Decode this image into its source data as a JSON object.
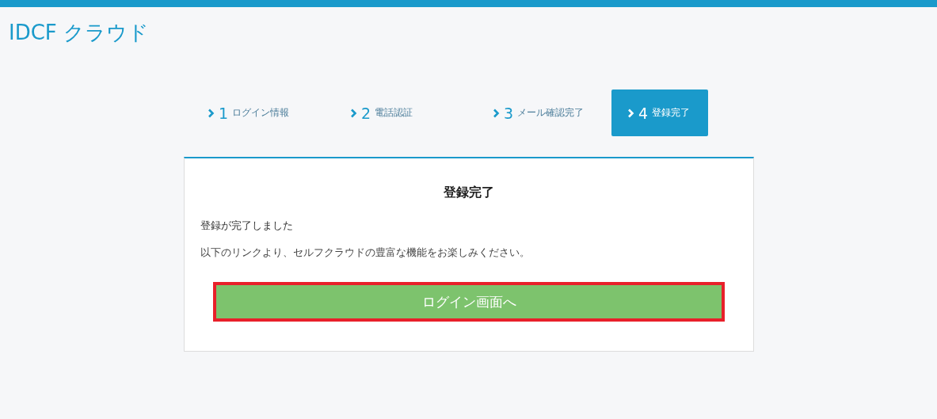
{
  "header": {
    "logo": "IDCF クラウド"
  },
  "steps": [
    {
      "number": "1",
      "label": "ログイン情報",
      "selected": false
    },
    {
      "number": "2",
      "label": "電話認証",
      "selected": false
    },
    {
      "number": "3",
      "label": "メール確認完了",
      "selected": false
    },
    {
      "number": "4",
      "label": "登録完了",
      "selected": true
    }
  ],
  "card": {
    "title": "登録完了",
    "message": "登録が完了しました",
    "description": "以下のリンクより、セルフクラウドの豊富な機能をお楽しみください。",
    "button": {
      "label": "ログイン画面へ",
      "highlighted": true
    }
  }
}
